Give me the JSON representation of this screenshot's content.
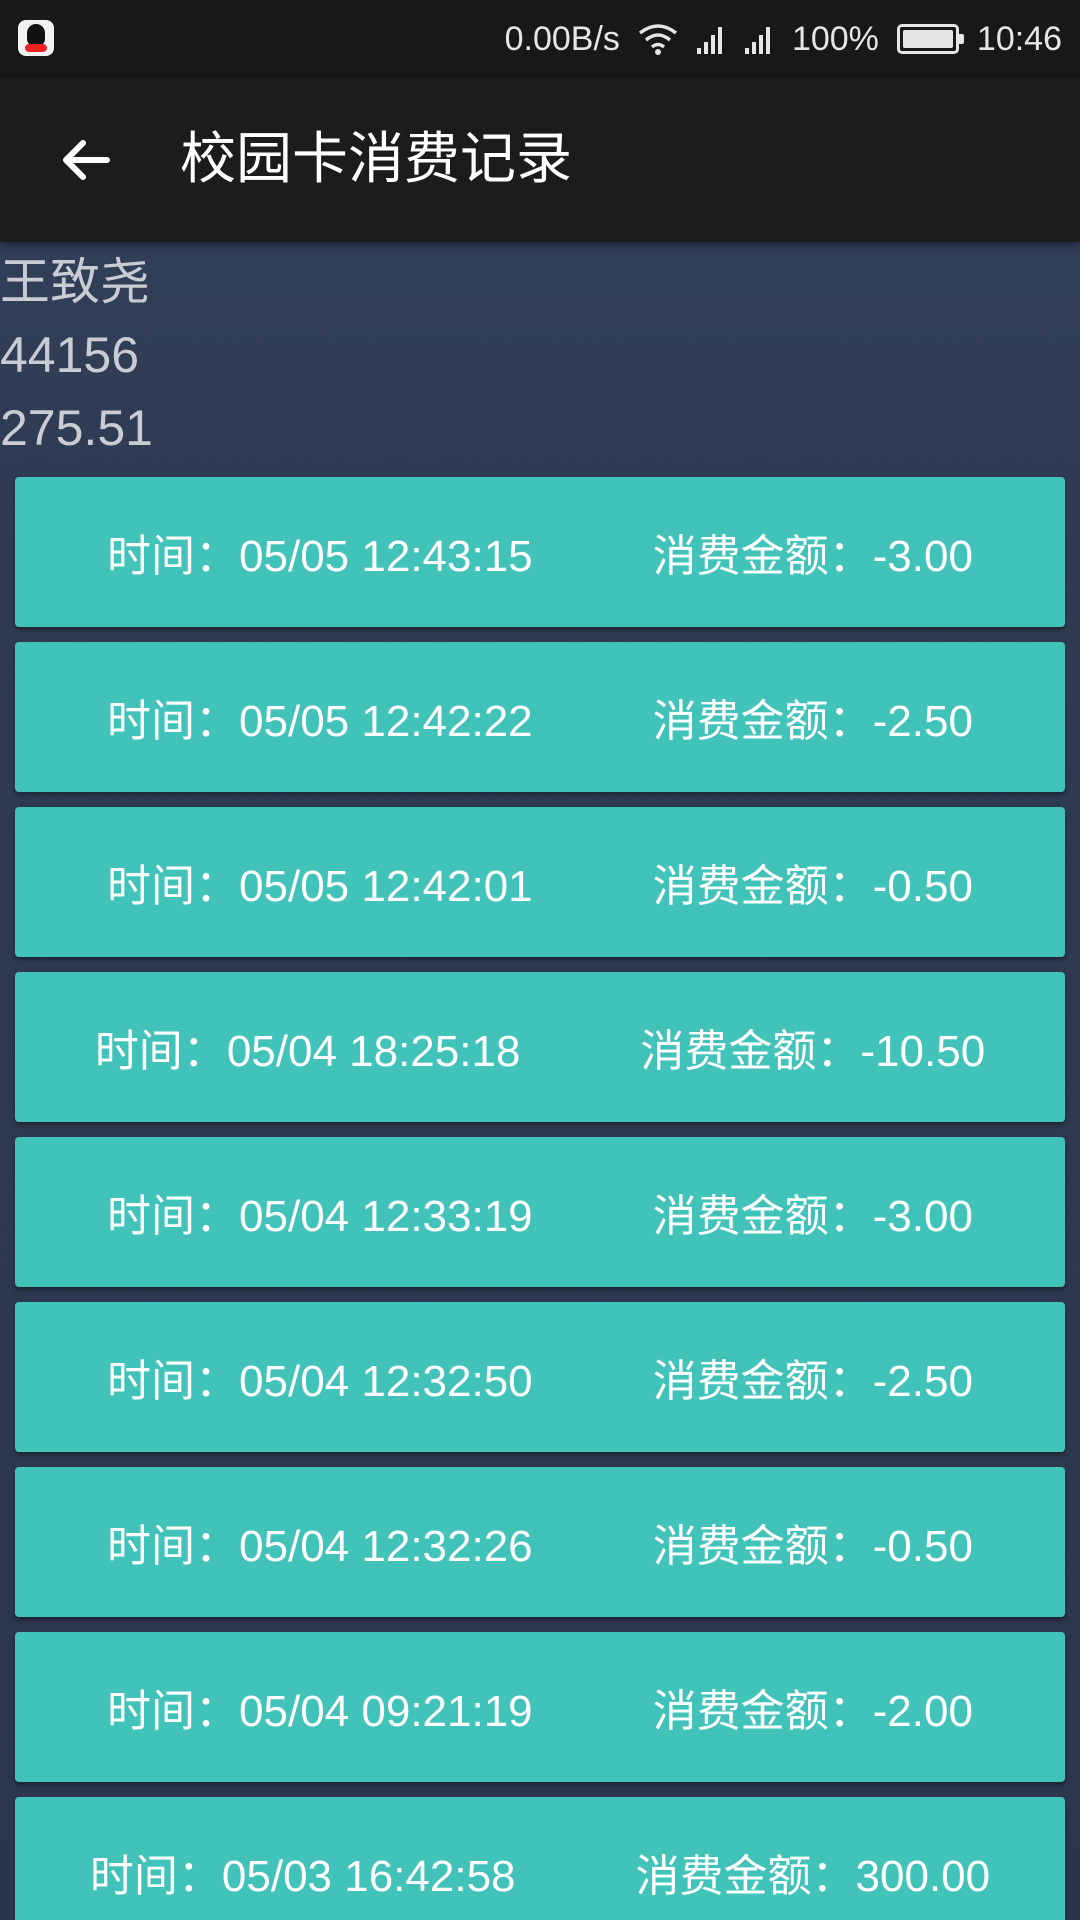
{
  "status_bar": {
    "net_speed": "0.00B/s",
    "battery": "100%",
    "time": "10:46",
    "icons": [
      "qq-icon",
      "wifi-icon",
      "signal-icon",
      "signal-icon",
      "battery-icon"
    ]
  },
  "app_bar": {
    "title": "校园卡消费记录",
    "back_icon": "arrow-left-icon"
  },
  "user": {
    "name": "王致尧",
    "id": "44156",
    "balance": "275.51"
  },
  "labels": {
    "time_prefix": "时间：",
    "amount_prefix": "消费金额："
  },
  "records": [
    {
      "time": "05/05 12:43:15",
      "amount": "-3.00"
    },
    {
      "time": "05/05 12:42:22",
      "amount": "-2.50"
    },
    {
      "time": "05/05 12:42:01",
      "amount": "-0.50"
    },
    {
      "time": "05/04 18:25:18",
      "amount": "-10.50"
    },
    {
      "time": "05/04 12:33:19",
      "amount": "-3.00"
    },
    {
      "time": "05/04 12:32:50",
      "amount": "-2.50"
    },
    {
      "time": "05/04 12:32:26",
      "amount": "-0.50"
    },
    {
      "time": "05/04 09:21:19",
      "amount": "-2.00"
    },
    {
      "time": "05/03 16:42:58",
      "amount": "300.00"
    }
  ],
  "colors": {
    "record_bg": "#41c3b9",
    "app_bar_bg": "#1c1c1c",
    "page_bg": "#2f3b52"
  }
}
